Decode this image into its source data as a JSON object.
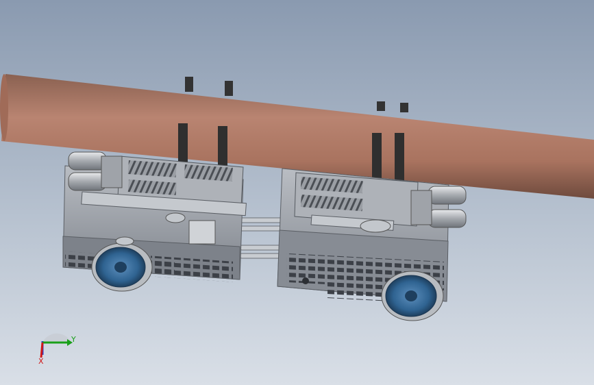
{
  "window": {
    "background_top": "#8a9ab0",
    "background_bottom": "#d9dfe7"
  },
  "model": {
    "pipe_color": "#b07a68",
    "frame_color": "#8e939b",
    "wheel_color": "#3b6f9c",
    "cable_color": "#3a3a3a"
  },
  "triad": {
    "y_label": "Y",
    "x_label": "X",
    "y_color": "#1aa01a",
    "x_color": "#d01818",
    "z_color": "#2a3cc8"
  }
}
